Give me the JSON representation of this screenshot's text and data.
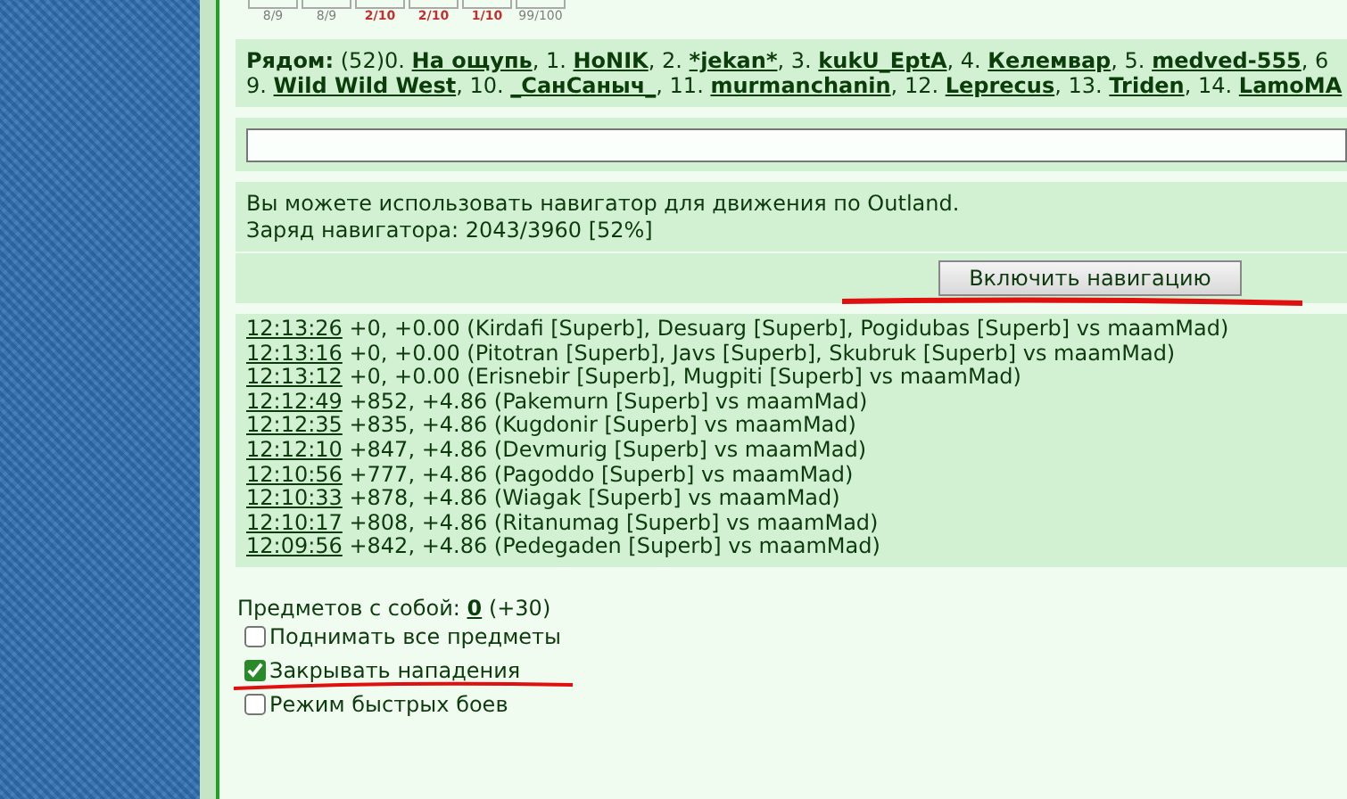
{
  "stats": [
    {
      "value": "8/9",
      "color": "#808080"
    },
    {
      "value": "8/9",
      "color": "#808080"
    },
    {
      "value": "2/10",
      "color": "#c03030"
    },
    {
      "value": "2/10",
      "color": "#c03030"
    },
    {
      "value": "1/10",
      "color": "#c03030"
    },
    {
      "value": "99/100",
      "color": "#808080"
    }
  ],
  "nearby": {
    "label": "Рядом:",
    "count": "(52)",
    "separator": ",",
    "lines": [
      {
        "players": [
          {
            "number": "0.",
            "name": "На ощупь"
          },
          {
            "number": "1.",
            "name": "HoNIK"
          },
          {
            "number": "2.",
            "name": "*jekan*"
          },
          {
            "number": "3.",
            "name": "kukU_EptA"
          },
          {
            "number": "4.",
            "name": "Келемвар"
          },
          {
            "number": "5.",
            "name": "medved-555"
          }
        ],
        "trailing": "6"
      },
      {
        "players": [
          {
            "number": "9.",
            "name": "Wild Wild West"
          },
          {
            "number": "10.",
            "name": "_СанСаныч_"
          },
          {
            "number": "11.",
            "name": "murmanchanin"
          },
          {
            "number": "12.",
            "name": "Leprecus"
          },
          {
            "number": "13.",
            "name": "Triden"
          },
          {
            "number": "14.",
            "name": "LamoMA"
          }
        ]
      }
    ]
  },
  "navigator": {
    "lines": [
      "Вы можете использовать навигатор для движения по Outland.",
      "Заряд навигатора: 2043/3960 [52%]"
    ],
    "button": "Включить навигацию"
  },
  "log": [
    {
      "time": "12:13:26",
      "text": "+0, +0.00 (Kirdafi [Superb], Desuarg [Superb], Pogidubas [Superb] vs maamMad)"
    },
    {
      "time": "12:13:16",
      "text": "+0, +0.00 (Pitotran [Superb], Javs [Superb], Skubruk [Superb] vs maamMad)"
    },
    {
      "time": "12:13:12",
      "text": "+0, +0.00 (Erisnebir [Superb], Mugpiti [Superb] vs maamMad)"
    },
    {
      "time": "12:12:49",
      "text": "+852, +4.86 (Pakemurn [Superb] vs maamMad)"
    },
    {
      "time": "12:12:35",
      "text": "+835, +4.86 (Kugdonir [Superb] vs maamMad)"
    },
    {
      "time": "12:12:10",
      "text": "+847, +4.86 (Devmurig [Superb] vs maamMad)"
    },
    {
      "time": "12:10:56",
      "text": "+777, +4.86 (Pagoddo [Superb] vs maamMad)"
    },
    {
      "time": "12:10:33",
      "text": "+878, +4.86 (Wiagak [Superb] vs maamMad)"
    },
    {
      "time": "12:10:17",
      "text": "+808, +4.86 (Ritanumag [Superb] vs maamMad)"
    },
    {
      "time": "12:09:56",
      "text": "+842, +4.86 (Pedegaden [Superb] vs maamMad)"
    }
  ],
  "items": {
    "label": "Предметов с собой:",
    "count": "0",
    "extra": "(+30)",
    "options": [
      {
        "label": "Поднимать все предметы",
        "checked": false
      },
      {
        "label": "Закрывать нападения",
        "checked": true
      },
      {
        "label": "Режим быстрых боев",
        "checked": false
      }
    ]
  }
}
